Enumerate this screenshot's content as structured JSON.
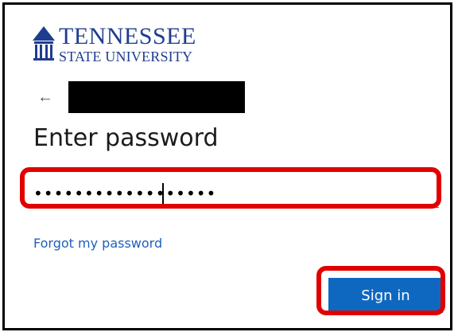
{
  "brand": {
    "logo_line1": "TENNESSEE",
    "logo_line2": "STATE UNIVERSITY",
    "logo_icon": "tsu-building-icon",
    "brand_color": "#1f3d8f"
  },
  "identity": {
    "back_icon": "arrow-left-icon",
    "username": ""
  },
  "page": {
    "title": "Enter password"
  },
  "password": {
    "masked_value": "••••••••••••••••••"
  },
  "links": {
    "forgot": "Forgot my password"
  },
  "actions": {
    "sign_in": "Sign in",
    "primary_color": "#0f68c0"
  },
  "annotations": {
    "highlight_color": "#e00000"
  }
}
